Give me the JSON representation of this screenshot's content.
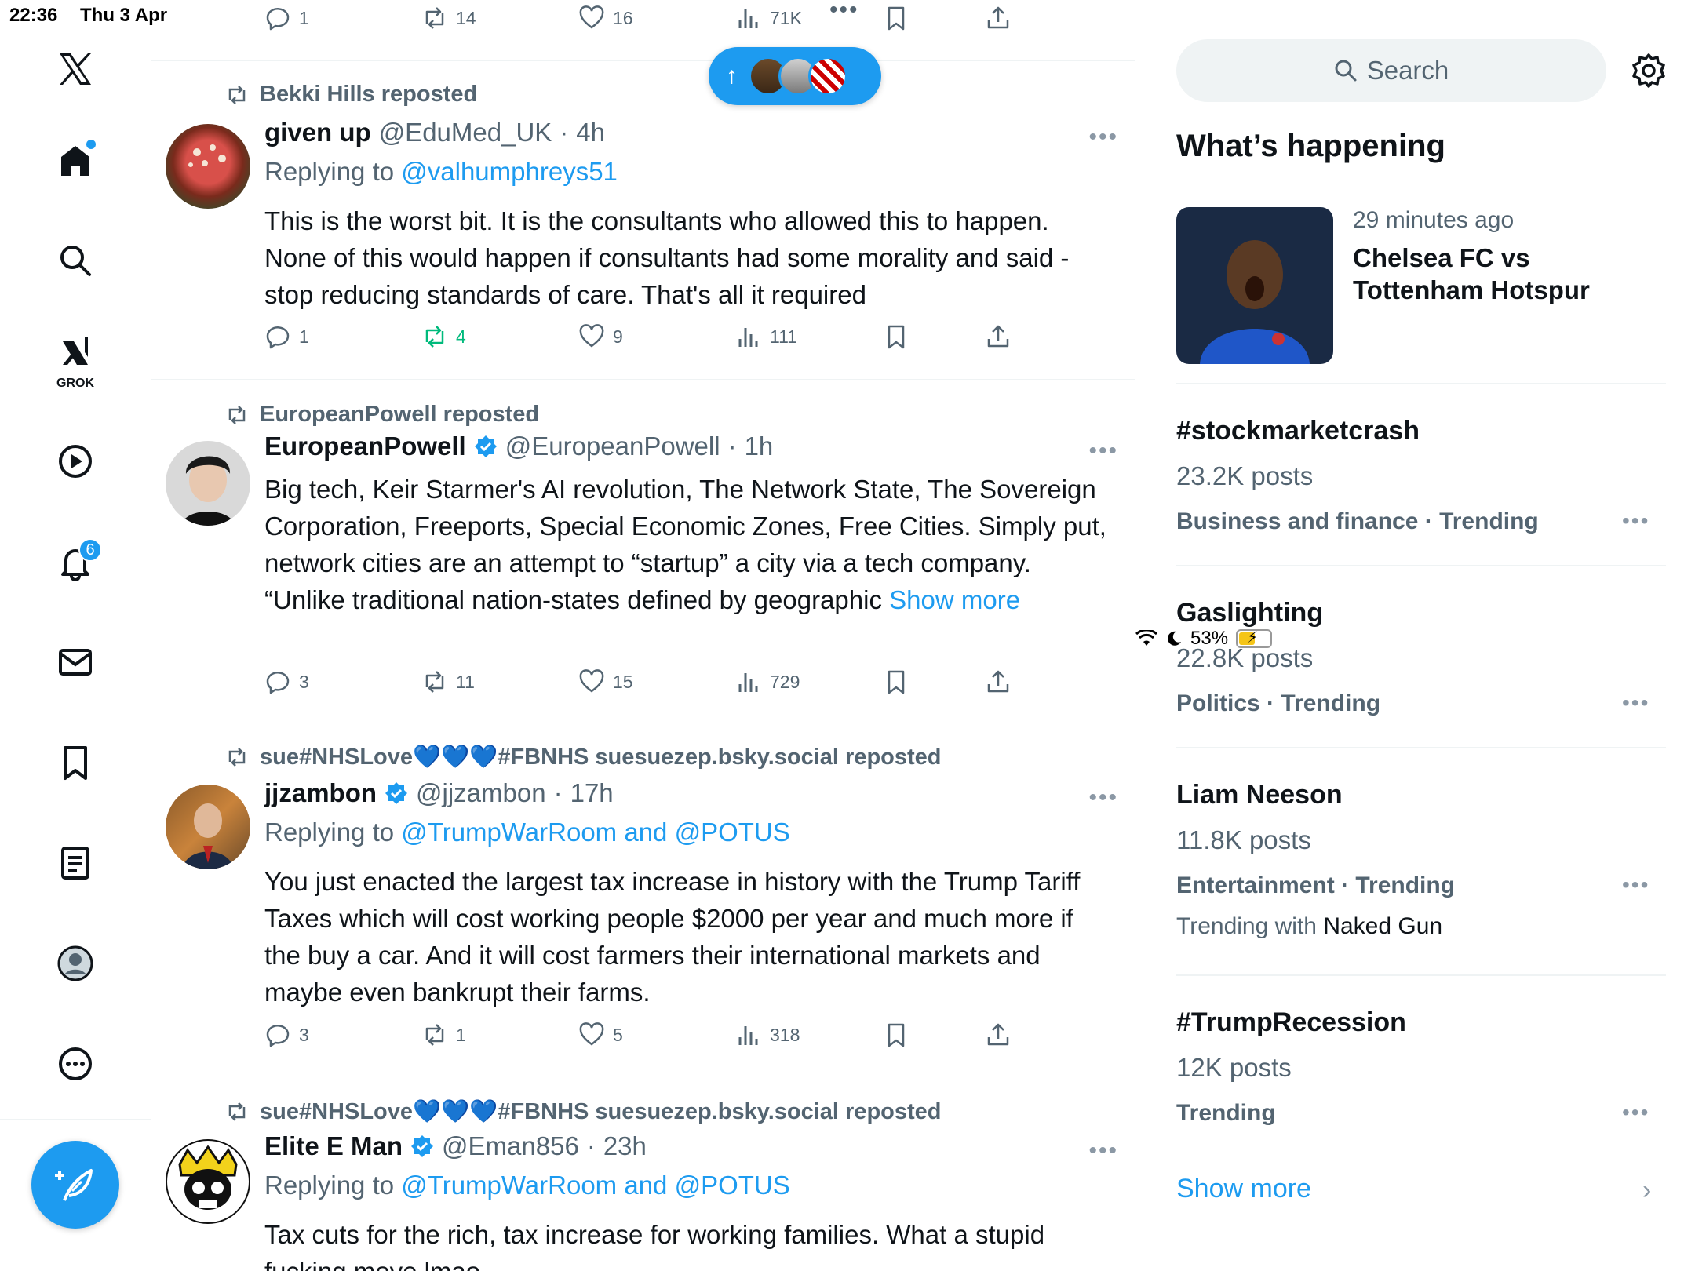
{
  "status": {
    "time": "22:36",
    "date": "Thu 3 Apr",
    "battery": "53%"
  },
  "nav": {
    "grok_label": "GROK",
    "notifications_count": "6"
  },
  "new_posts_arrow": "↑",
  "top_actions": {
    "reply": "1",
    "repost": "14",
    "like": "16",
    "views": "71K"
  },
  "tweets": [
    {
      "reposted_by": "Bekki Hills reposted",
      "name": "given up",
      "handle": "@EduMed_UK",
      "time": "4h",
      "replying_prefix": "Replying to ",
      "replying_to": "@valhumphreys51",
      "text": "This is the worst bit. It is the consultants who allowed this to happen. None of this would happen if consultants had some morality and said - stop reducing standards of care. That's all it required",
      "show_more": "",
      "reply": "1",
      "repost": "4",
      "like": "9",
      "views": "111"
    },
    {
      "reposted_by": "EuropeanPowell reposted",
      "name": "EuropeanPowell",
      "handle": "@EuropeanPowell",
      "time": "1h",
      "replying_prefix": "",
      "replying_to": "",
      "text": "Big tech, Keir Starmer's AI revolution, The Network State, The Sovereign Corporation, Freeports, Special Economic Zones, Free Cities. Simply put, network cities are an attempt to “startup” a city via a tech company.\n“Unlike traditional nation-states defined by geographic ",
      "show_more": "Show more",
      "reply": "3",
      "repost": "11",
      "like": "15",
      "views": "729"
    },
    {
      "reposted_by": "sue#NHSLove💙💙💙#FBNHS suesuezep.bsky.social reposted",
      "name": "jjzambon",
      "handle": "@jjzambon",
      "time": "17h",
      "replying_prefix": "Replying to ",
      "replying_to": "@TrumpWarRoom and @POTUS",
      "text": "You just enacted the largest tax increase in history with the Trump Tariff Taxes which will cost working people $2000 per year and much more if the buy a car. And it will cost farmers their international markets and maybe even bankrupt their farms.",
      "show_more": "",
      "reply": "3",
      "repost": "1",
      "like": "5",
      "views": "318"
    },
    {
      "reposted_by": "sue#NHSLove💙💙💙#FBNHS suesuezep.bsky.social reposted",
      "name": "Elite E Man",
      "handle": "@Eman856",
      "time": "23h",
      "replying_prefix": "Replying to ",
      "replying_to": "@TrumpWarRoom and @POTUS",
      "text": "Tax cuts for the rich, tax increase for working families. What a stupid fucking move lmao",
      "show_more": "",
      "reply": "",
      "repost": "",
      "like": "",
      "views": ""
    }
  ],
  "sidebar": {
    "search_placeholder": "Search",
    "whats_happening": "What’s happening",
    "news": {
      "time": "29 minutes ago",
      "title": "Chelsea FC vs Tottenham Hotspur"
    },
    "trends": [
      {
        "title": "#stockmarketcrash",
        "posts": "23.2K posts",
        "category": "Business and finance · Trending",
        "with_prefix": "",
        "with_value": ""
      },
      {
        "title": "Gaslighting",
        "posts": "22.8K posts",
        "category": "Politics · Trending",
        "with_prefix": "",
        "with_value": ""
      },
      {
        "title": "Liam Neeson",
        "posts": "11.8K posts",
        "category": "Entertainment · Trending",
        "with_prefix": "Trending with ",
        "with_value": "Naked Gun"
      },
      {
        "title": "#TrumpRecession",
        "posts": "12K posts",
        "category": "Trending",
        "with_prefix": "",
        "with_value": ""
      }
    ],
    "show_more": "Show more"
  },
  "colors": {
    "accent": "#1d9bf0",
    "secondary_text": "#536471",
    "repost_green": "#00ba7c"
  }
}
